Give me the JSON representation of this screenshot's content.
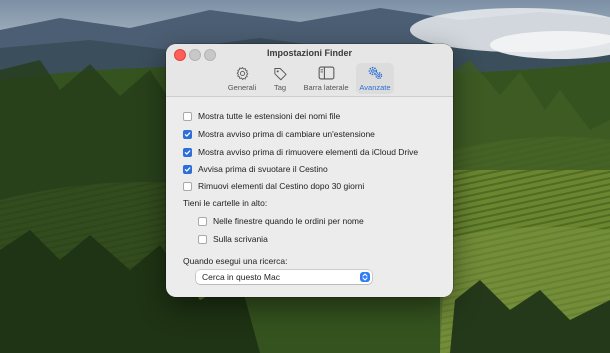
{
  "window": {
    "title": "Impostazioni Finder",
    "tabs": [
      {
        "id": "generali",
        "label": "Generali",
        "icon": "gear-icon",
        "active": false
      },
      {
        "id": "tag",
        "label": "Tag",
        "icon": "tag-icon",
        "active": false
      },
      {
        "id": "barra-laterale",
        "label": "Barra laterale",
        "icon": "sidebar-icon",
        "active": false
      },
      {
        "id": "avanzate",
        "label": "Avanzate",
        "icon": "gears-icon",
        "active": true
      }
    ]
  },
  "options": [
    {
      "label": "Mostra tutte le estensioni dei nomi file",
      "checked": false
    },
    {
      "label": "Mostra avviso prima di cambiare un'estensione",
      "checked": true
    },
    {
      "label": "Mostra avviso prima di rimuovere elementi da iCloud Drive",
      "checked": true
    },
    {
      "label": "Avvisa prima di svuotare il Cestino",
      "checked": true
    },
    {
      "label": "Rimuovi elementi dal Cestino dopo 30 giorni",
      "checked": false
    }
  ],
  "folders": {
    "heading": "Tieni le cartelle in alto:",
    "items": [
      {
        "label": "Nelle finestre quando le ordini per nome",
        "checked": false
      },
      {
        "label": "Sulla scrivania",
        "checked": false
      }
    ]
  },
  "search": {
    "heading": "Quando esegui una ricerca:",
    "selected": "Cerca in questo Mac"
  },
  "colors": {
    "accent": "#2c6fd9",
    "close": "#fe5f57",
    "window_bg": "#ececec"
  }
}
